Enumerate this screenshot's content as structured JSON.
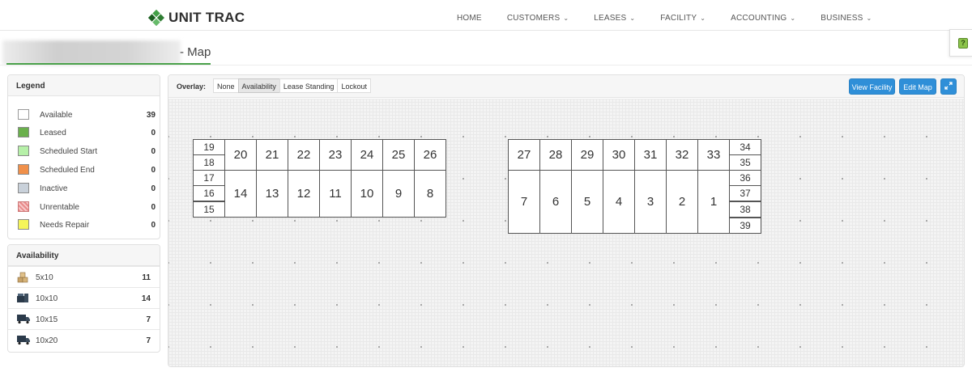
{
  "brand": {
    "name": "UNIT TRAC"
  },
  "nav": {
    "items": [
      {
        "label": "HOME",
        "dropdown": false
      },
      {
        "label": "CUSTOMERS",
        "dropdown": true
      },
      {
        "label": "LEASES",
        "dropdown": true
      },
      {
        "label": "FACILITY",
        "dropdown": true
      },
      {
        "label": "ACCOUNTING",
        "dropdown": true
      },
      {
        "label": "BUSINESS",
        "dropdown": true
      }
    ]
  },
  "help": {
    "icon": "help-icon",
    "glyph": "?"
  },
  "page": {
    "title": "- Map"
  },
  "legend": {
    "title": "Legend",
    "items": [
      {
        "label": "Available",
        "count": "39",
        "color": "#ffffff"
      },
      {
        "label": "Leased",
        "count": "0",
        "color": "#6ab04c"
      },
      {
        "label": "Scheduled Start",
        "count": "0",
        "color": "#b6f0a8"
      },
      {
        "label": "Scheduled End",
        "count": "0",
        "color": "#f0904a"
      },
      {
        "label": "Inactive",
        "count": "0",
        "color": "#c9d1da"
      },
      {
        "label": "Unrentable",
        "count": "0",
        "color": "#e88a8a"
      },
      {
        "label": "Needs Repair",
        "count": "0",
        "color": "#f5f55a"
      }
    ]
  },
  "availability": {
    "title": "Availability",
    "items": [
      {
        "label": "5x10",
        "count": "11",
        "icon": "boxes-icon"
      },
      {
        "label": "10x10",
        "count": "14",
        "icon": "furniture-icon"
      },
      {
        "label": "10x15",
        "count": "7",
        "icon": "truck-icon"
      },
      {
        "label": "10x20",
        "count": "7",
        "icon": "truck-icon"
      }
    ]
  },
  "map": {
    "overlay_label": "Overlay:",
    "overlay_options": [
      "None",
      "Availability",
      "Lease Standing",
      "Lockout"
    ],
    "overlay_selected": "Availability",
    "view_facility_label": "View Facility",
    "edit_map_label": "Edit Map",
    "expand_icon": "expand-icon",
    "units": [
      "1",
      "2",
      "3",
      "4",
      "5",
      "6",
      "7",
      "8",
      "9",
      "10",
      "11",
      "12",
      "13",
      "14",
      "15",
      "16",
      "17",
      "18",
      "19",
      "20",
      "21",
      "22",
      "23",
      "24",
      "25",
      "26",
      "27",
      "28",
      "29",
      "30",
      "31",
      "32",
      "33",
      "34",
      "35",
      "36",
      "37",
      "38",
      "39"
    ]
  },
  "colors": {
    "accent": "#2f8fd8",
    "brand_green": "#2e8b3a",
    "title_underline": "#4aa14a"
  }
}
